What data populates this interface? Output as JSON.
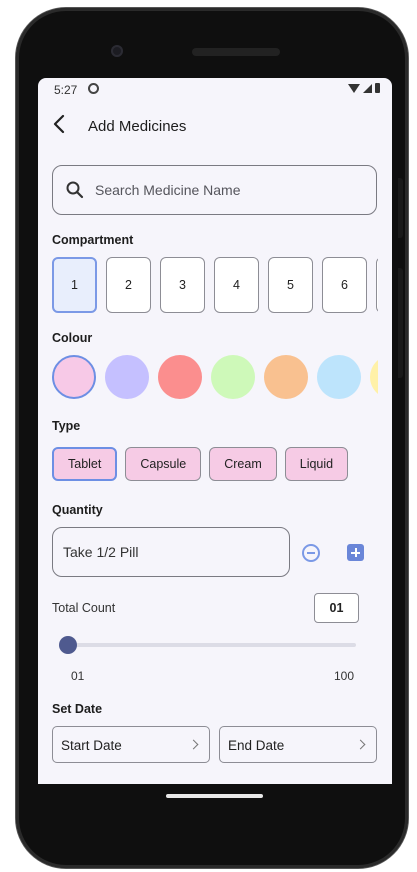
{
  "status_bar": {
    "time": "5:27"
  },
  "header": {
    "title": "Add Medicines"
  },
  "search": {
    "placeholder": "Search Medicine Name"
  },
  "compartment": {
    "label": "Compartment",
    "items": [
      "1",
      "2",
      "3",
      "4",
      "5",
      "6"
    ],
    "selected": "1"
  },
  "colour": {
    "label": "Colour",
    "swatches": [
      "#f7c9e7",
      "#c5c0ff",
      "#fb8e8e",
      "#cef9b9",
      "#f9c190",
      "#bde4fc",
      "#fff1a8"
    ],
    "selected_index": 0,
    "accent": "#6d8fe4"
  },
  "type": {
    "label": "Type",
    "options": [
      "Tablet",
      "Capsule",
      "Cream",
      "Liquid"
    ],
    "selected": "Tablet"
  },
  "quantity": {
    "label": "Quantity",
    "value": "Take 1/2 Pill"
  },
  "total_count": {
    "label": "Total Count",
    "value": "01",
    "slider_min_label": "01",
    "slider_max_label": "100",
    "slider_fraction": 0.0
  },
  "set_date": {
    "label": "Set Date",
    "start_label": "Start Date",
    "end_label": "End Date"
  }
}
